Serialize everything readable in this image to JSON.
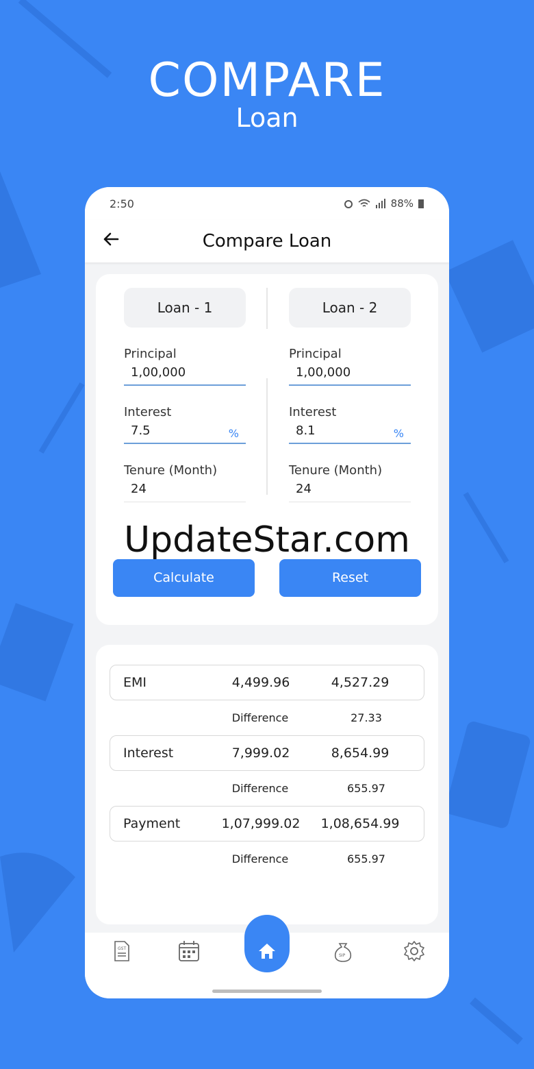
{
  "hero": {
    "title": "COMPARE",
    "subtitle": "Loan"
  },
  "statusbar": {
    "time": "2:50",
    "battery": "88%"
  },
  "appbar": {
    "title": "Compare Loan"
  },
  "loans": [
    {
      "tab": "Loan - 1",
      "principal_label": "Principal",
      "principal": "1,00,000",
      "interest_label": "Interest",
      "interest": "7.5",
      "interest_unit": "%",
      "tenure_label": "Tenure (Month)",
      "tenure": "24"
    },
    {
      "tab": "Loan - 2",
      "principal_label": "Principal",
      "principal": "1,00,000",
      "interest_label": "Interest",
      "interest": "8.1",
      "interest_unit": "%",
      "tenure_label": "Tenure (Month)",
      "tenure": "24"
    }
  ],
  "buttons": {
    "calculate": "Calculate",
    "reset": "Reset"
  },
  "watermark": "UpdateStar.com",
  "results": [
    {
      "label": "EMI",
      "loan1": "4,499.96",
      "loan2": "4,527.29",
      "diff_label": "Difference",
      "diff": "27.33"
    },
    {
      "label": "Interest",
      "loan1": "7,999.02",
      "loan2": "8,654.99",
      "diff_label": "Difference",
      "diff": "655.97"
    },
    {
      "label": "Payment",
      "loan1": "1,07,999.02",
      "loan2": "1,08,654.99",
      "diff_label": "Difference",
      "diff": "655.97"
    }
  ],
  "nav": {
    "items": [
      "gst-icon",
      "calendar-icon",
      "home-icon",
      "sip-icon",
      "settings-icon"
    ],
    "gst_text": "GST",
    "sip_text": "SIP"
  },
  "colors": {
    "primary": "#3a86f4",
    "background": "#3a86f4",
    "card": "#ffffff"
  }
}
